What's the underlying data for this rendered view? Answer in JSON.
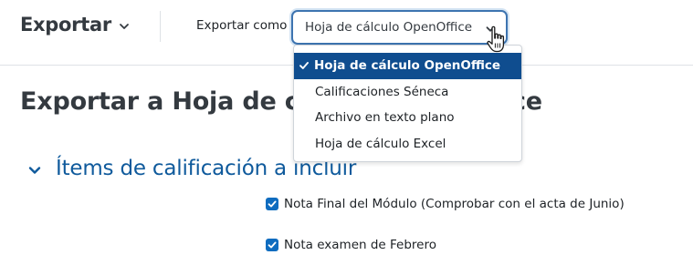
{
  "header": {
    "title": "Exportar",
    "export_as_label": "Exportar como"
  },
  "select": {
    "current_value": "Hoja de cálculo OpenOffice",
    "options": [
      {
        "label": "Hoja de cálculo OpenOffice",
        "selected": true
      },
      {
        "label": "Calificaciones Séneca",
        "selected": false
      },
      {
        "label": "Archivo en texto plano",
        "selected": false
      },
      {
        "label": "Hoja de cálculo Excel",
        "selected": false
      }
    ]
  },
  "main": {
    "heading": "Exportar a Hoja de cálculo OpenOffice",
    "section_title": "Ítems de calificación a incluir",
    "grade_items": [
      {
        "label": "Nota Final del Módulo (Comprobar con el acta de Junio)",
        "checked": true
      },
      {
        "label": "Nota examen de Febrero",
        "checked": true
      }
    ]
  },
  "colors": {
    "accent": "#0f6cbf",
    "selected_option_bg": "#0f4d8f",
    "section_title": "#0f5a9c",
    "select_border": "#3d74b0"
  },
  "icons": {
    "nav_dropdown": "chevron-down-icon",
    "select_dropdown": "chevron-down-icon",
    "selected_option": "check-icon",
    "section_toggle": "chevron-down-icon",
    "cursor": "hand-pointer-icon"
  }
}
